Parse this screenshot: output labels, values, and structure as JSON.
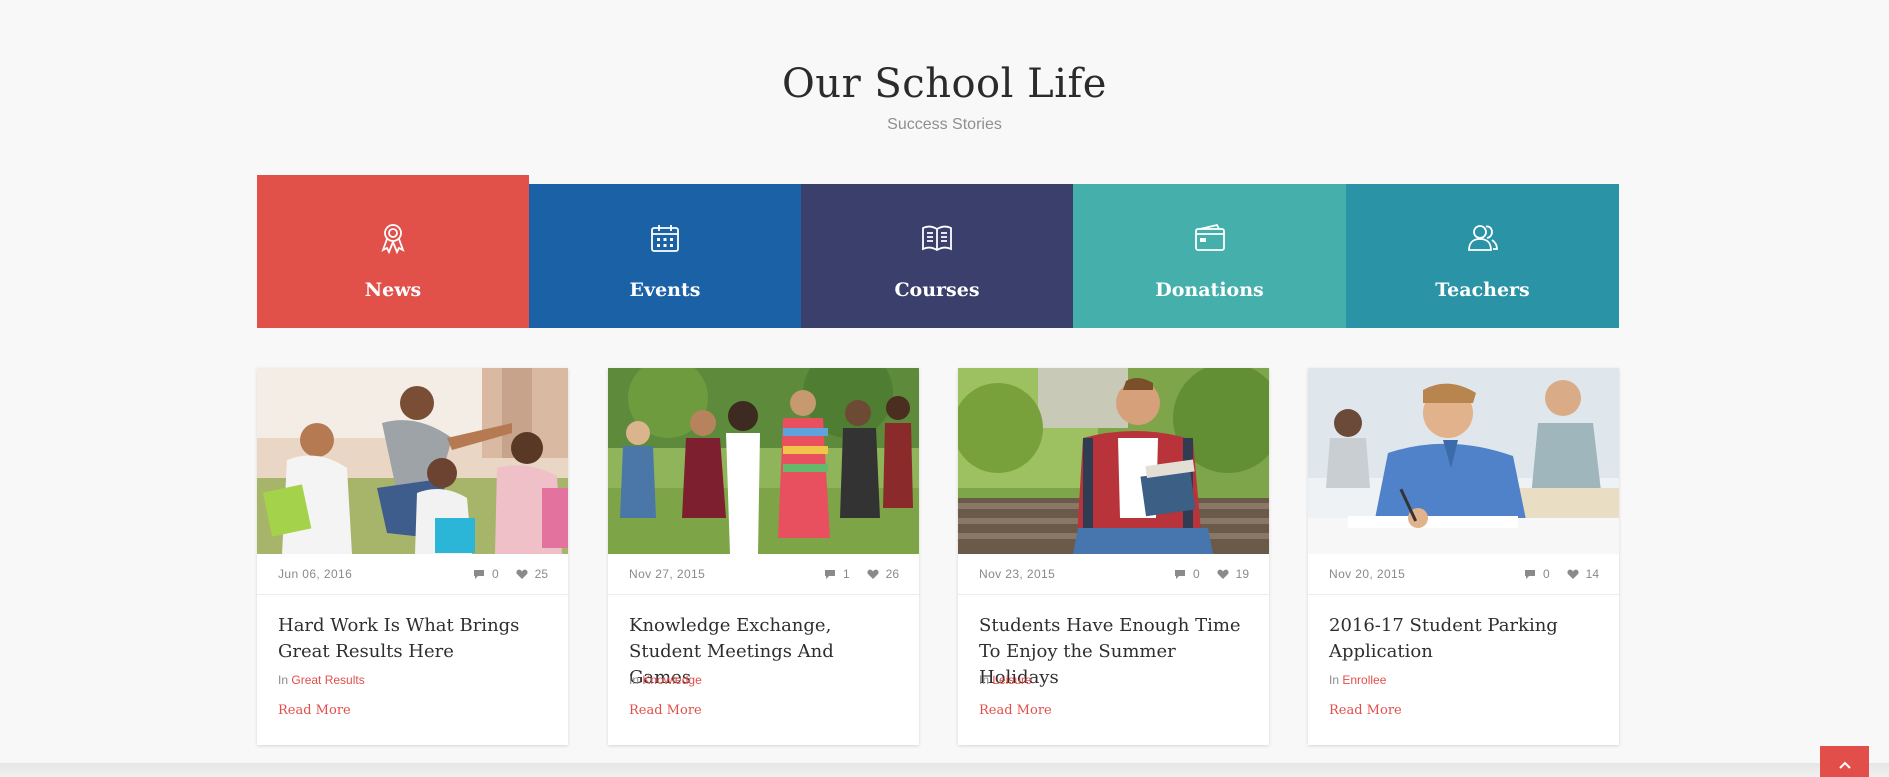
{
  "section": {
    "title": "Our School Life",
    "subtitle": "Success Stories"
  },
  "tabs": [
    {
      "label": "News",
      "icon": "award-icon",
      "color": "#e2504a",
      "active": true
    },
    {
      "label": "Events",
      "icon": "calendar-icon",
      "color": "#1b61a6"
    },
    {
      "label": "Courses",
      "icon": "book-icon",
      "color": "#3a3f6b"
    },
    {
      "label": "Donations",
      "icon": "wallet-icon",
      "color": "#45b0ab"
    },
    {
      "label": "Teachers",
      "icon": "users-icon",
      "color": "#2a93a6"
    }
  ],
  "posts": [
    {
      "date": "Jun 06, 2016",
      "comments": "0",
      "likes": "25",
      "title": "Hard Work Is What Brings Great Results Here",
      "category_prefix": "In",
      "category": "Great Results",
      "read_more": "Read More"
    },
    {
      "date": "Nov 27, 2015",
      "comments": "1",
      "likes": "26",
      "title": "Knowledge Exchange, Student Meetings And Games",
      "category_prefix": "In",
      "category": "Knowledge",
      "read_more": "Read More"
    },
    {
      "date": "Nov 23, 2015",
      "comments": "0",
      "likes": "19",
      "title": "Students Have Enough Time To Enjoy the Summer Holidays",
      "category_prefix": "In",
      "category": "Leisure",
      "read_more": "Read More"
    },
    {
      "date": "Nov 20, 2015",
      "comments": "0",
      "likes": "14",
      "title": "2016-17 Student Parking Application",
      "category_prefix": "In",
      "category": "Enrollee",
      "read_more": "Read More"
    }
  ],
  "colors": {
    "accent": "#e24f4b"
  },
  "back_to_top": {
    "icon": "chevron-up-icon"
  }
}
